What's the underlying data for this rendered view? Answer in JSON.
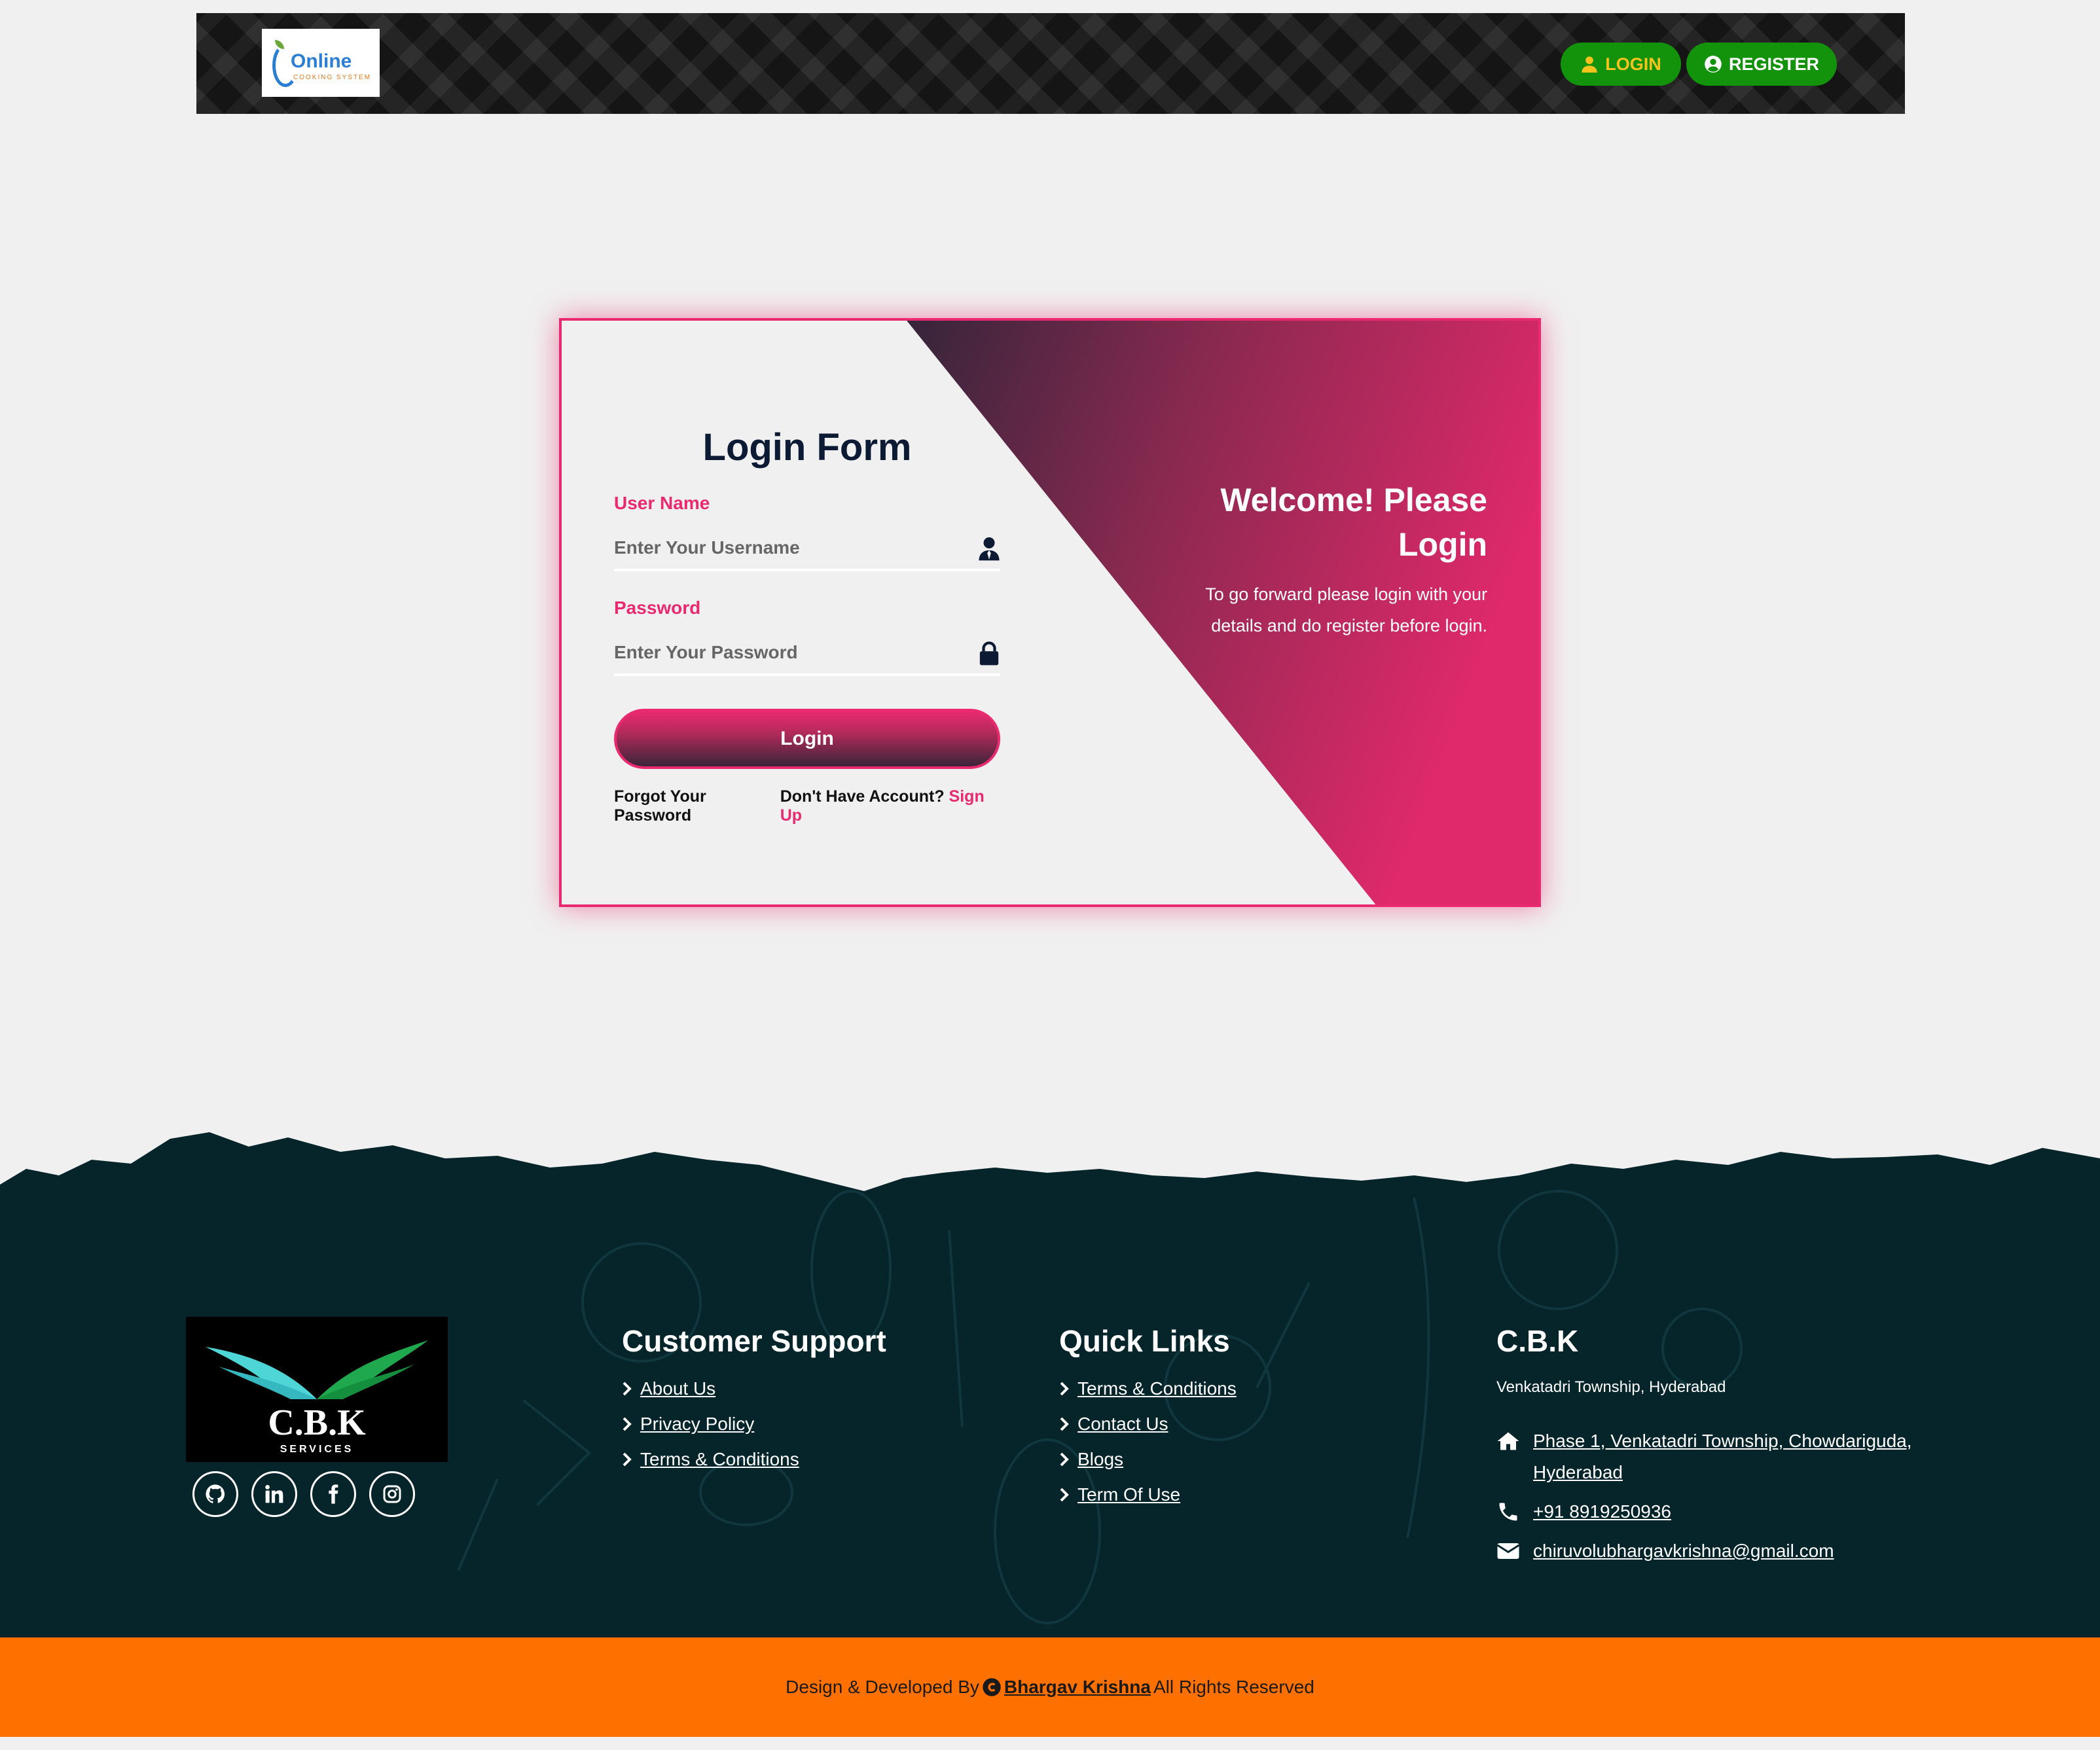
{
  "header": {
    "logo_text": "Online",
    "logo_sub": "COOKING SYSTEM",
    "login_label": "LOGIN",
    "register_label": "REGISTER"
  },
  "form": {
    "title": "Login Form",
    "username_label": "User Name",
    "username_placeholder": "Enter Your Username",
    "password_label": "Password",
    "password_placeholder": "Enter Your Password",
    "submit_label": "Login",
    "forgot_label": "Forgot Your Password",
    "no_account_label": "Don't Have Account?",
    "signup_label": "Sign Up"
  },
  "welcome": {
    "heading": "Welcome! Please Login",
    "text": "To go forward please login with your details and do register before login."
  },
  "footer": {
    "logo_title": "C.B.K",
    "logo_sub": "SERVICES",
    "socials": [
      "github-icon",
      "linkedin-icon",
      "facebook-icon",
      "instagram-icon"
    ],
    "customer_support": {
      "title": "Customer Support",
      "links": [
        "About Us",
        "Privacy Policy",
        "Terms & Conditions"
      ]
    },
    "quick_links": {
      "title": "Quick Links",
      "links": [
        "Terms & Conditions",
        "Contact Us",
        "Blogs",
        "Term Of Use"
      ]
    },
    "cbk": {
      "title": "C.B.K",
      "address_short": "Venkatadri Township, Hyderabad",
      "address_full": "Phase 1, Venkatadri Township, Chowdariguda, Hyderabad",
      "phone": "+91 8919250936",
      "email": "chiruvolubhargavkrishna@gmail.com"
    }
  },
  "bottom": {
    "prefix": "Design & Developed By",
    "author": "Bhargav Krishna",
    "suffix": "All Rights Reserved"
  },
  "colors": {
    "accent": "#ea2a6f",
    "header_button": "#12930b",
    "footer_bg": "#06252b",
    "bottom_bar": "#fe7100",
    "form_title": "#0c1a33"
  }
}
